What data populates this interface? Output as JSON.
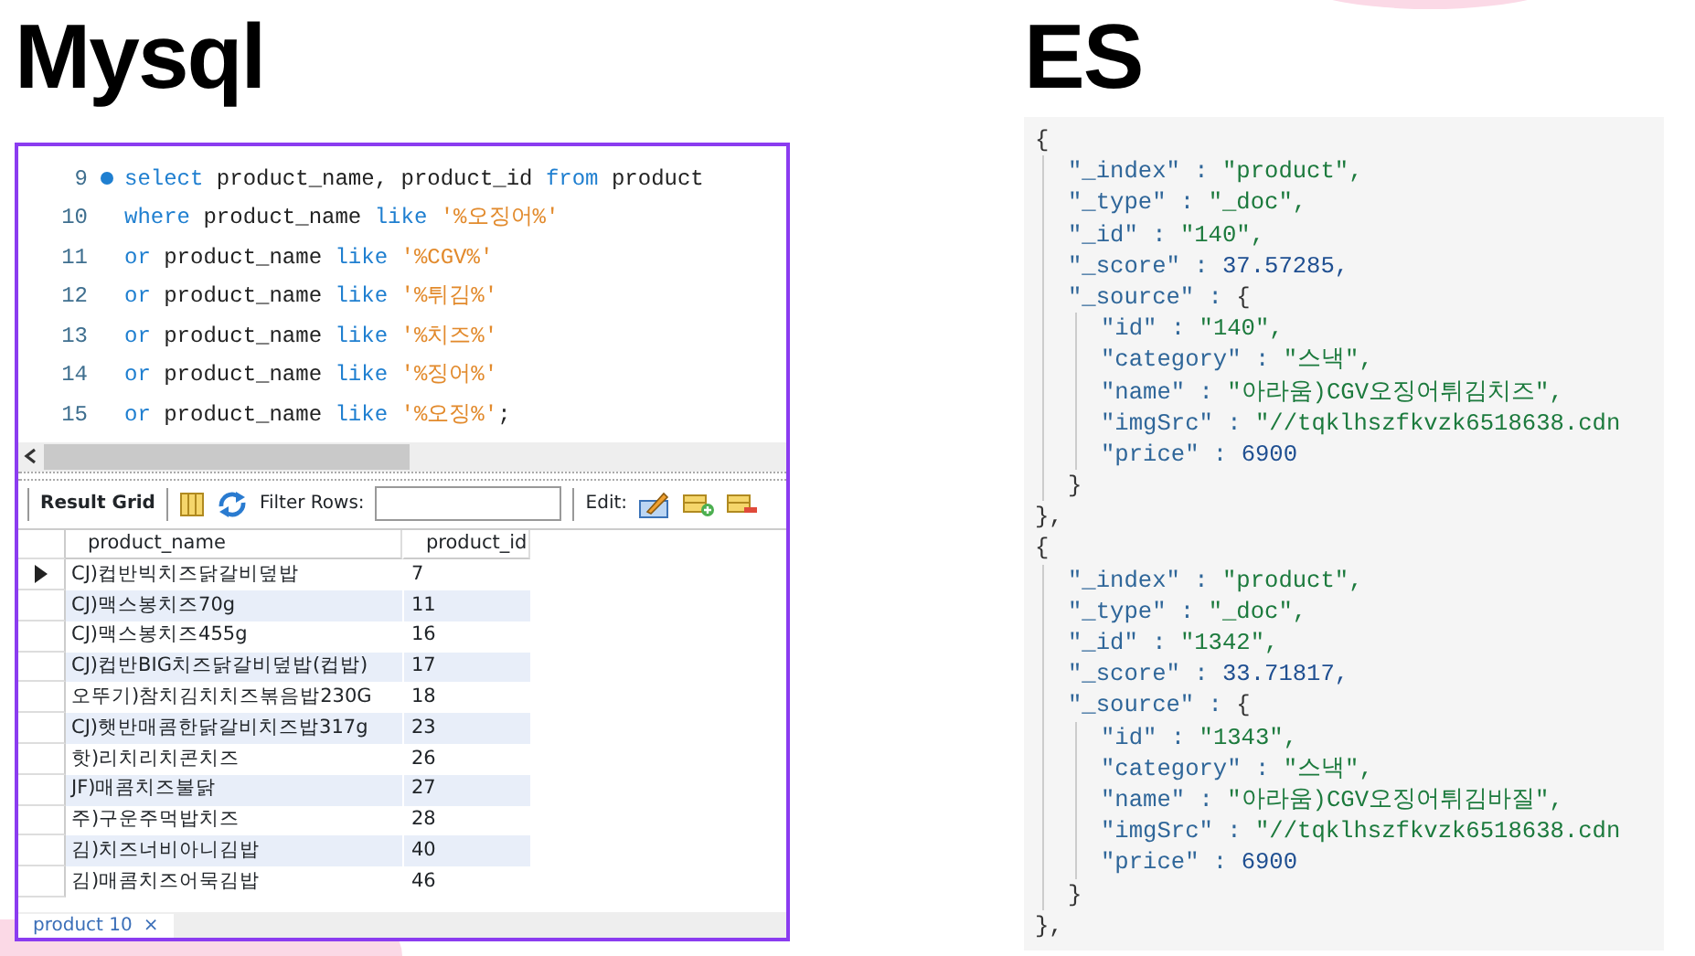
{
  "mysql": {
    "title": "Mysql",
    "editor": {
      "lines": [
        {
          "number": "9",
          "breakpoint": true,
          "tokens": [
            {
              "kind": "keyword",
              "text": "select"
            },
            {
              "kind": "plain",
              "text": " product_name, product_id "
            },
            {
              "kind": "keyword",
              "text": "from"
            },
            {
              "kind": "plain",
              "text": " product"
            }
          ]
        },
        {
          "number": "10",
          "breakpoint": false,
          "tokens": [
            {
              "kind": "keyword",
              "text": "where"
            },
            {
              "kind": "plain",
              "text": " product_name "
            },
            {
              "kind": "keyword",
              "text": "like"
            },
            {
              "kind": "string",
              "text": " '%오징어%'"
            }
          ]
        },
        {
          "number": "11",
          "breakpoint": false,
          "tokens": [
            {
              "kind": "keyword",
              "text": "or"
            },
            {
              "kind": "plain",
              "text": " product_name "
            },
            {
              "kind": "keyword",
              "text": "like"
            },
            {
              "kind": "string",
              "text": " '%CGV%'"
            }
          ]
        },
        {
          "number": "12",
          "breakpoint": false,
          "tokens": [
            {
              "kind": "keyword",
              "text": "or"
            },
            {
              "kind": "plain",
              "text": " product_name "
            },
            {
              "kind": "keyword",
              "text": "like"
            },
            {
              "kind": "string",
              "text": " '%튀김%'"
            }
          ]
        },
        {
          "number": "13",
          "breakpoint": false,
          "tokens": [
            {
              "kind": "keyword",
              "text": "or"
            },
            {
              "kind": "plain",
              "text": " product_name "
            },
            {
              "kind": "keyword",
              "text": "like"
            },
            {
              "kind": "string",
              "text": " '%치즈%'"
            }
          ]
        },
        {
          "number": "14",
          "breakpoint": false,
          "tokens": [
            {
              "kind": "keyword",
              "text": "or"
            },
            {
              "kind": "plain",
              "text": " product_name "
            },
            {
              "kind": "keyword",
              "text": "like"
            },
            {
              "kind": "string",
              "text": " '%징어%'"
            }
          ]
        },
        {
          "number": "15",
          "breakpoint": false,
          "tokens": [
            {
              "kind": "keyword",
              "text": "or"
            },
            {
              "kind": "plain",
              "text": " product_name "
            },
            {
              "kind": "keyword",
              "text": "like"
            },
            {
              "kind": "string",
              "text": " '%오징%'"
            },
            {
              "kind": "plain",
              "text": ";"
            }
          ]
        }
      ]
    },
    "toolbar": {
      "result_grid": "Result Grid",
      "filter_label": "Filter Rows:",
      "edit_label": "Edit:"
    },
    "grid": {
      "columns": [
        "product_name",
        "product_id"
      ],
      "rows": [
        {
          "cells": [
            "CJ)컵반빅치즈닭갈비덮밥",
            "7"
          ],
          "selected": true
        },
        {
          "cells": [
            "CJ)맥스봉치즈70g",
            "11"
          ],
          "selected": false
        },
        {
          "cells": [
            "CJ)맥스봉치즈455g",
            "16"
          ],
          "selected": false
        },
        {
          "cells": [
            "CJ)컵반BIG치즈닭갈비덮밥(컵밥)",
            "17"
          ],
          "selected": false
        },
        {
          "cells": [
            "오뚜기)참치김치치즈볶음밥230G",
            "18"
          ],
          "selected": false
        },
        {
          "cells": [
            "CJ)햇반매콤한닭갈비치즈밥317g",
            "23"
          ],
          "selected": false
        },
        {
          "cells": [
            "핫)리치리치콘치즈",
            "26"
          ],
          "selected": false
        },
        {
          "cells": [
            "JF)매콤치즈불닭",
            "27"
          ],
          "selected": false
        },
        {
          "cells": [
            "주)구운주먹밥치즈",
            "28"
          ],
          "selected": false
        },
        {
          "cells": [
            "김)치즈너비아니김밥",
            "40"
          ],
          "selected": false
        },
        {
          "cells": [
            "김)매콤치즈어묵김밥",
            "46"
          ],
          "selected": false
        }
      ]
    },
    "tab": {
      "label": "product 10",
      "close": "×"
    }
  },
  "es": {
    "title": "ES",
    "documents": [
      {
        "open": "{",
        "close": "},",
        "fields": [
          {
            "key": "\"_index\" :",
            "value": "\"product\",",
            "kind": "string"
          },
          {
            "key": "\"_type\" :",
            "value": "\"_doc\",",
            "kind": "string"
          },
          {
            "key": "\"_id\" :",
            "value": "\"140\",",
            "kind": "string"
          },
          {
            "key": "\"_score\" :",
            "value": "37.57285,",
            "kind": "number"
          },
          {
            "key": "\"_source\" :",
            "value": "{",
            "kind": "object",
            "close": "}",
            "children": [
              {
                "key": "\"id\" :",
                "value": "\"140\",",
                "kind": "string"
              },
              {
                "key": "\"category\" :",
                "value": "\"스낵\",",
                "kind": "string"
              },
              {
                "key": "\"name\" :",
                "value": "\"아라움)CGV오징어튀김치즈\",",
                "kind": "string"
              },
              {
                "key": "\"imgSrc\" :",
                "value": "\"//tqklhszfkvzk6518638.cdn",
                "kind": "string"
              },
              {
                "key": "\"price\" :",
                "value": "6900",
                "kind": "number"
              }
            ]
          }
        ]
      },
      {
        "open": "{",
        "close": "},",
        "fields": [
          {
            "key": "\"_index\" :",
            "value": "\"product\",",
            "kind": "string"
          },
          {
            "key": "\"_type\" :",
            "value": "\"_doc\",",
            "kind": "string"
          },
          {
            "key": "\"_id\" :",
            "value": "\"1342\",",
            "kind": "string"
          },
          {
            "key": "\"_score\" :",
            "value": "33.71817,",
            "kind": "number"
          },
          {
            "key": "\"_source\" :",
            "value": "{",
            "kind": "object",
            "close": "}",
            "children": [
              {
                "key": "\"id\" :",
                "value": "\"1343\",",
                "kind": "string"
              },
              {
                "key": "\"category\" :",
                "value": "\"스낵\",",
                "kind": "string"
              },
              {
                "key": "\"name\" :",
                "value": "\"아라움)CGV오징어튀김바질\",",
                "kind": "string"
              },
              {
                "key": "\"imgSrc\" :",
                "value": "\"//tqklhszfkvzk6518638.cdn",
                "kind": "string"
              },
              {
                "key": "\"price\" :",
                "value": "6900",
                "kind": "number"
              }
            ]
          }
        ]
      }
    ]
  }
}
